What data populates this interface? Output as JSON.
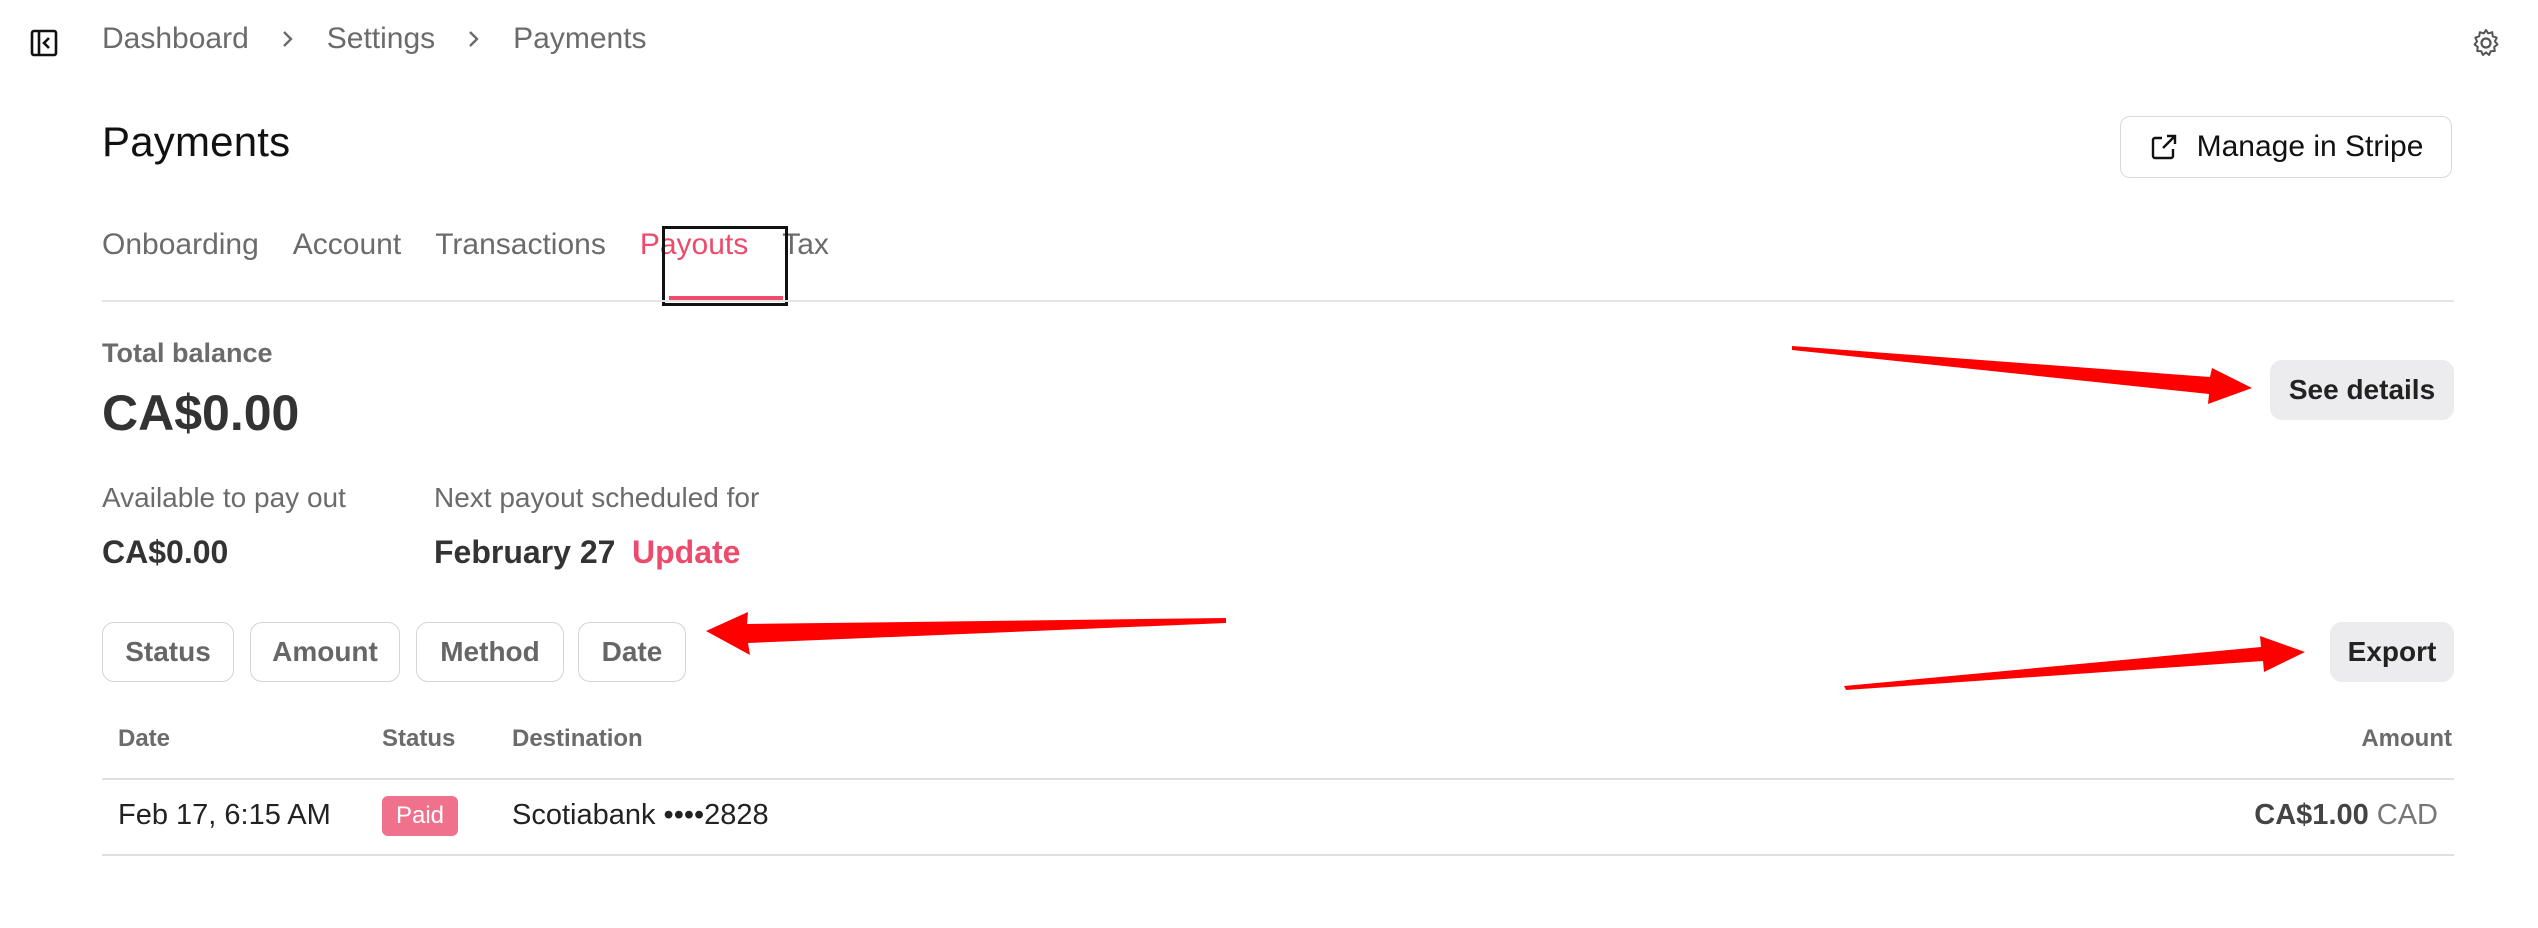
{
  "breadcrumb": [
    "Dashboard",
    "Settings",
    "Payments"
  ],
  "page": {
    "title": "Payments",
    "manage_button": "Manage in Stripe"
  },
  "tabs": [
    {
      "label": "Onboarding",
      "active": false
    },
    {
      "label": "Account",
      "active": false
    },
    {
      "label": "Transactions",
      "active": false
    },
    {
      "label": "Payouts",
      "active": true
    },
    {
      "label": "Tax",
      "active": false
    }
  ],
  "balance": {
    "total_label": "Total balance",
    "total_value": "CA$0.00",
    "see_details": "See details",
    "available_label": "Available to pay out",
    "available_value": "CA$0.00",
    "next_label": "Next payout scheduled for",
    "next_value": "February 27",
    "update_link": "Update"
  },
  "filters": [
    "Status",
    "Amount",
    "Method",
    "Date"
  ],
  "export_label": "Export",
  "table": {
    "columns": [
      "Date",
      "Status",
      "Destination",
      "Amount"
    ],
    "rows": [
      {
        "date": "Feb 17, 6:15 AM",
        "status": "Paid",
        "destination": "Scotiabank ••••2828",
        "amount": "CA$1.00",
        "currency": "CAD"
      }
    ]
  },
  "colors": {
    "accent": "#ee4a6b",
    "badge_paid": "#f0718b",
    "annotation_arrow": "#ff0000"
  },
  "icons": [
    "sidebar-toggle-icon",
    "chevron-right-icon",
    "gear-icon",
    "external-link-icon"
  ]
}
